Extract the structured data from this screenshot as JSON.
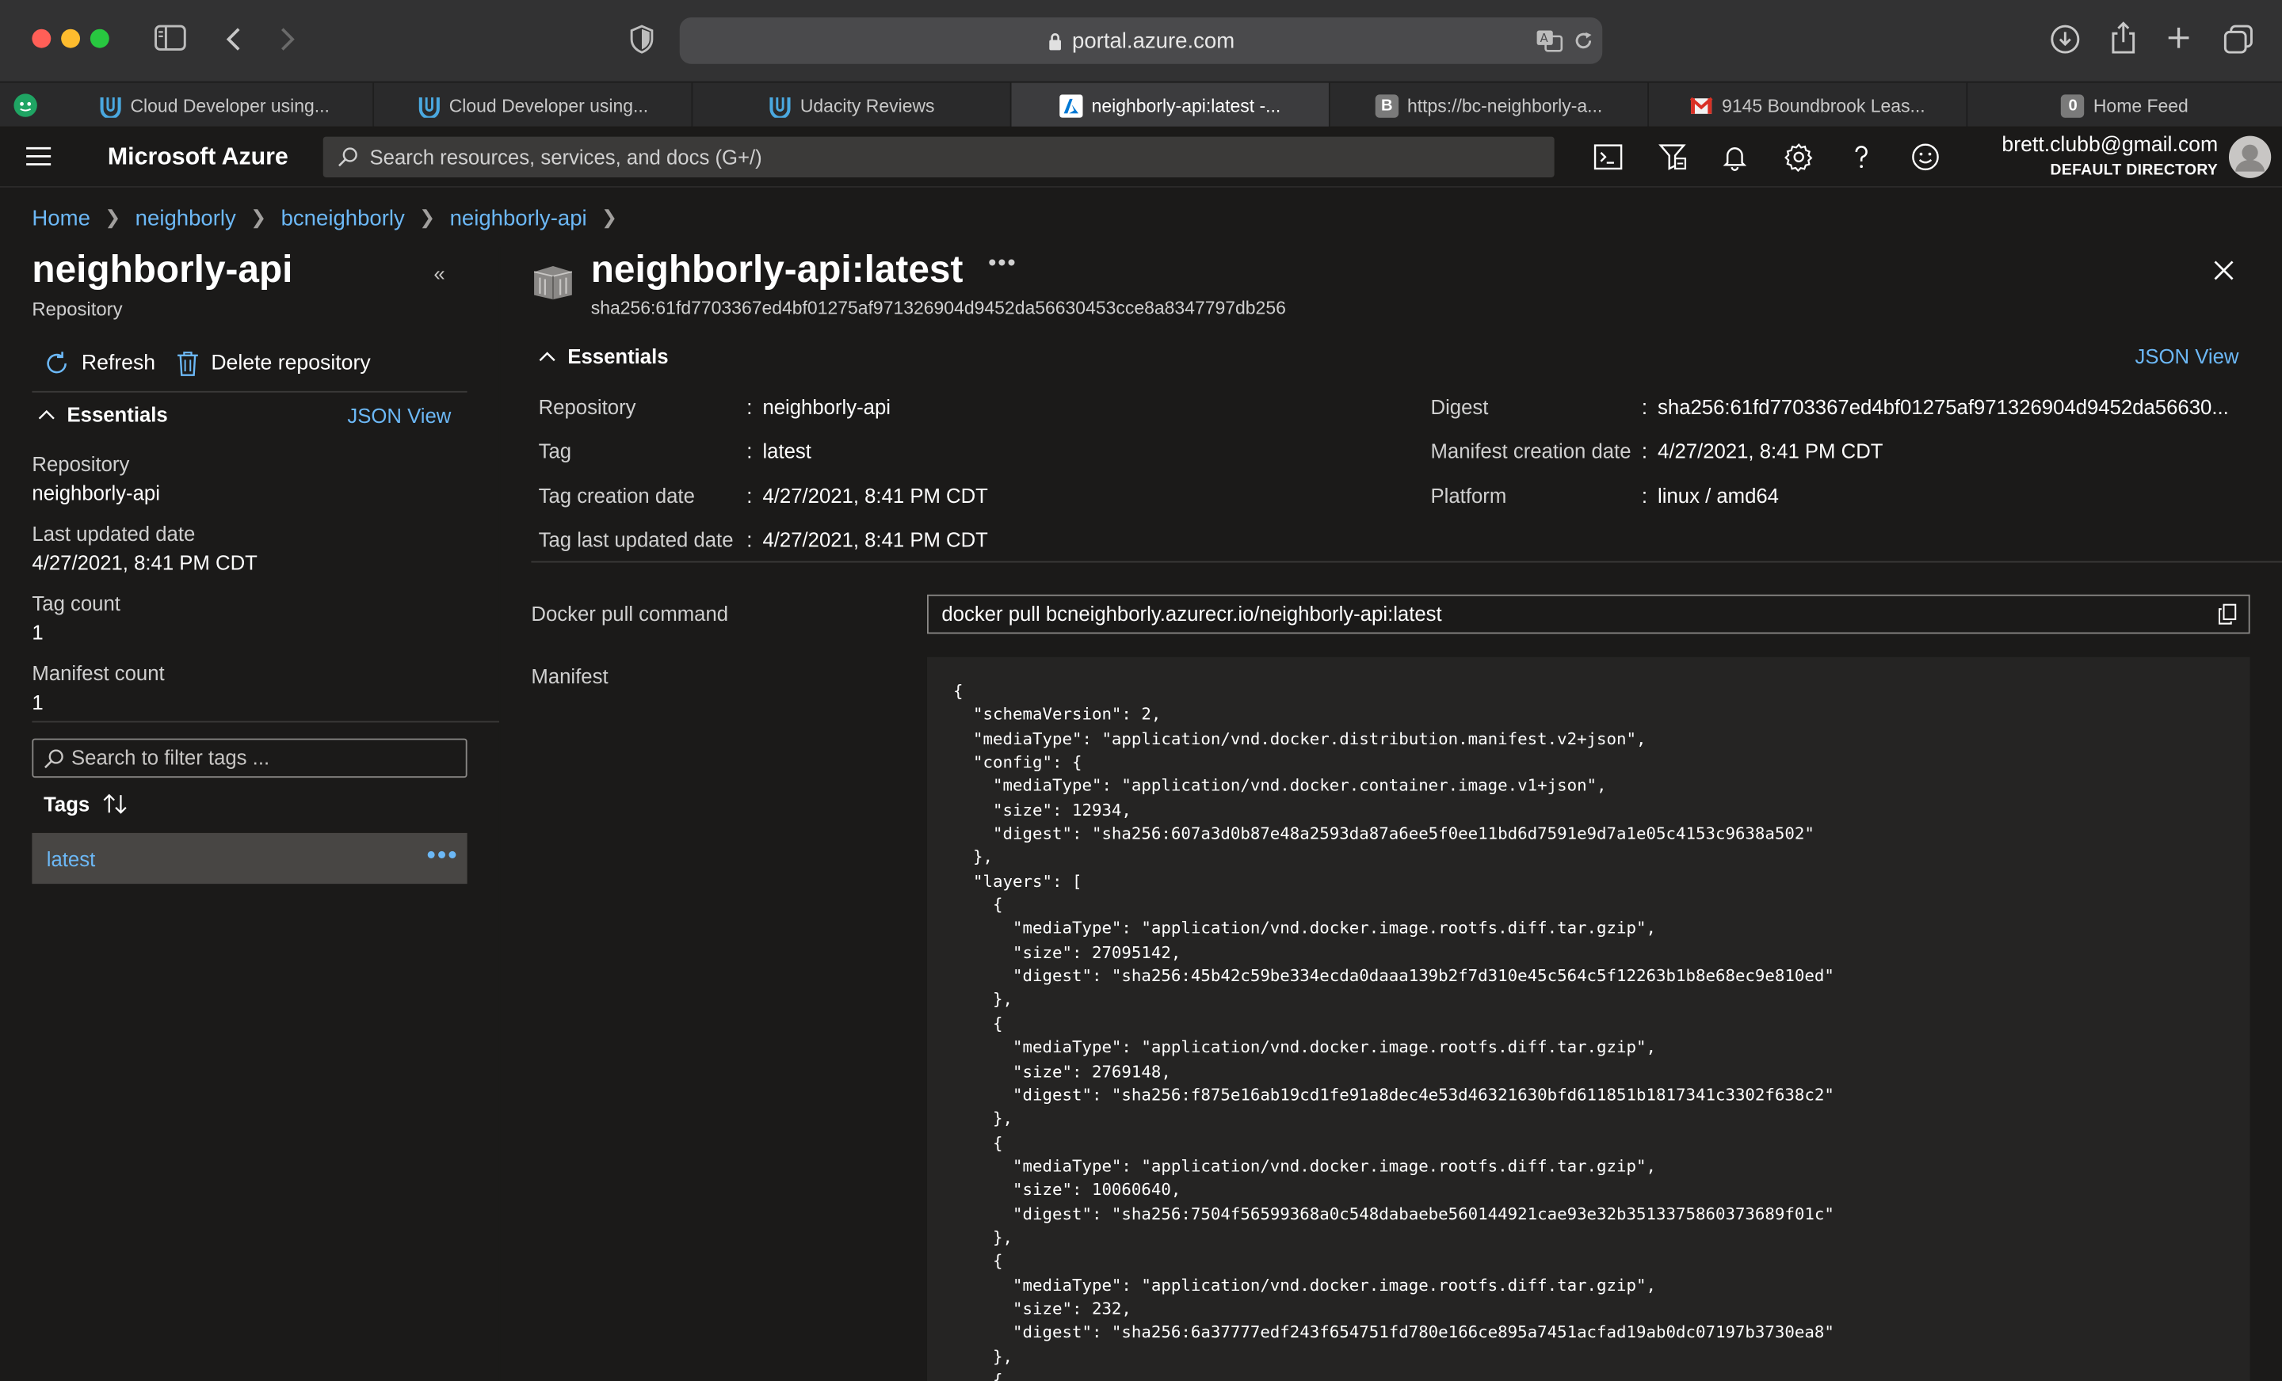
{
  "browser": {
    "url": "portal.azure.com",
    "tabs": [
      {
        "label": "Cloud Developer using...",
        "icon": "udacity-icon"
      },
      {
        "label": "Cloud Developer using...",
        "icon": "udacity-icon"
      },
      {
        "label": "Udacity Reviews",
        "icon": "udacity-icon"
      },
      {
        "label": "neighborly-api:latest -...",
        "icon": "azure-icon",
        "active": true
      },
      {
        "label": "https://bc-neighborly-a...",
        "icon": "b-letter-icon",
        "icon_text": "B"
      },
      {
        "label": "9145 Boundbrook Leas...",
        "icon": "gmail-icon"
      },
      {
        "label": "Home Feed",
        "icon": "zero-badge-icon",
        "icon_text": "0"
      }
    ]
  },
  "portal": {
    "brand": "Microsoft Azure",
    "search_placeholder": "Search resources, services, and docs (G+/)",
    "user_email": "brett.clubb@gmail.com",
    "user_directory": "DEFAULT DIRECTORY"
  },
  "breadcrumb": [
    "Home",
    "neighborly",
    "bcneighborly",
    "neighborly-api"
  ],
  "left_pane": {
    "title": "neighborly-api",
    "subtitle": "Repository",
    "refresh_label": "Refresh",
    "delete_label": "Delete repository",
    "essentials_label": "Essentials",
    "json_view_label": "JSON View",
    "properties": [
      {
        "label": "Repository",
        "value": "neighborly-api"
      },
      {
        "label": "Last updated date",
        "value": "4/27/2021, 8:41 PM CDT"
      },
      {
        "label": "Tag count",
        "value": "1"
      },
      {
        "label": "Manifest count",
        "value": "1"
      }
    ],
    "filter_placeholder": "Search to filter tags ...",
    "tags_header": "Tags",
    "tags": [
      "latest"
    ],
    "more_label": "•••"
  },
  "right_pane": {
    "title": "neighborly-api:latest",
    "subtitle": "sha256:61fd7703367ed4bf01275af971326904d9452da56630453cce8a8347797db256",
    "more_label": "•••",
    "essentials_label": "Essentials",
    "json_view_label": "JSON View",
    "essentials_left": [
      {
        "label": "Repository",
        "value": "neighborly-api"
      },
      {
        "label": "Tag",
        "value": "latest"
      },
      {
        "label": "Tag creation date",
        "value": "4/27/2021, 8:41 PM CDT"
      },
      {
        "label": "Tag last updated date",
        "value": "4/27/2021, 8:41 PM CDT"
      }
    ],
    "essentials_right": [
      {
        "label": "Digest",
        "value": "sha256:61fd7703367ed4bf01275af971326904d9452da56630..."
      },
      {
        "label": "Manifest creation date",
        "value": "4/27/2021, 8:41 PM CDT"
      },
      {
        "label": "Platform",
        "value": "linux / amd64"
      }
    ],
    "colon": ":",
    "docker_pull_label": "Docker pull command",
    "docker_pull_command": "docker pull bcneighborly.azurecr.io/neighborly-api:latest",
    "manifest_label": "Manifest",
    "manifest_text": "{\n  \"schemaVersion\": 2,\n  \"mediaType\": \"application/vnd.docker.distribution.manifest.v2+json\",\n  \"config\": {\n    \"mediaType\": \"application/vnd.docker.container.image.v1+json\",\n    \"size\": 12934,\n    \"digest\": \"sha256:607a3d0b87e48a2593da87a6ee5f0ee11bd6d7591e9d7a1e05c4153c9638a502\"\n  },\n  \"layers\": [\n    {\n      \"mediaType\": \"application/vnd.docker.image.rootfs.diff.tar.gzip\",\n      \"size\": 27095142,\n      \"digest\": \"sha256:45b42c59be334ecda0daaa139b2f7d310e45c564c5f12263b1b8e68ec9e810ed\"\n    },\n    {\n      \"mediaType\": \"application/vnd.docker.image.rootfs.diff.tar.gzip\",\n      \"size\": 2769148,\n      \"digest\": \"sha256:f875e16ab19cd1fe91a8dec4e53d46321630bfd611851b1817341c3302f638c2\"\n    },\n    {\n      \"mediaType\": \"application/vnd.docker.image.rootfs.diff.tar.gzip\",\n      \"size\": 10060640,\n      \"digest\": \"sha256:7504f56599368a0c548dabaebe560144921cae93e32b3513375860373689f01c\"\n    },\n    {\n      \"mediaType\": \"application/vnd.docker.image.rootfs.diff.tar.gzip\",\n      \"size\": 232,\n      \"digest\": \"sha256:6a37777edf243f654751fd780e166ce895a7451acfad19ab0dc07197b3730ea8\"\n    },\n    {"
  },
  "colors": {
    "link": "#6cb8f6",
    "background": "#1b1a19",
    "selected_row": "#484644",
    "code_background": "#252423"
  }
}
